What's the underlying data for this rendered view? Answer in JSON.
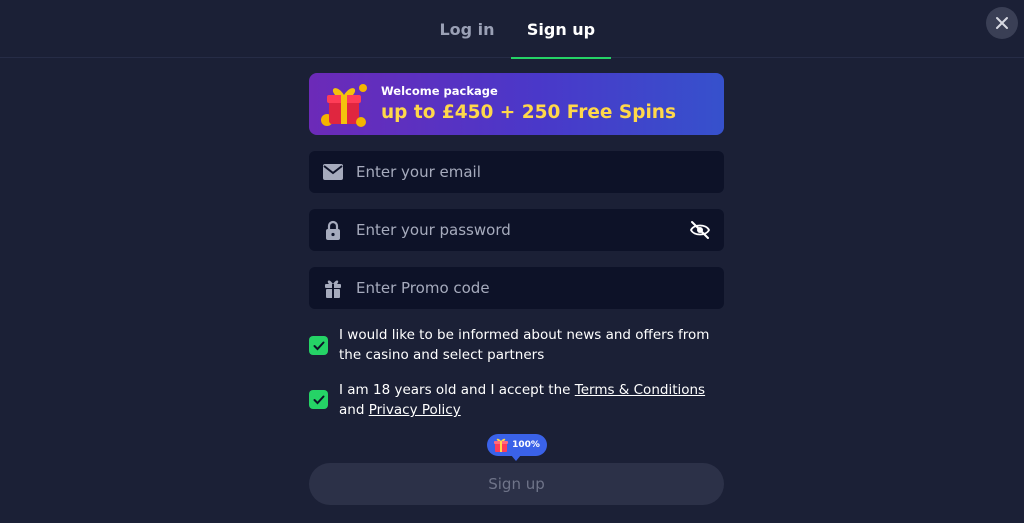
{
  "tabs": {
    "login": "Log in",
    "signup": "Sign up"
  },
  "banner": {
    "subtitle": "Welcome package",
    "title": "up to £450 + 250 Free Spins"
  },
  "form": {
    "email_placeholder": "Enter your email",
    "password_placeholder": "Enter your password",
    "promo_placeholder": "Enter Promo code"
  },
  "consents": {
    "news_text": "I would like to be informed about news and offers from the casino and select partners",
    "news_checked": true,
    "age_prefix": "I am 18 years old and I accept the",
    "terms_link": "Terms & Conditions",
    "age_and": "and",
    "privacy_link": "Privacy Policy",
    "age_checked": true
  },
  "progress": {
    "label": "100%",
    "percent": 100
  },
  "submit_label": "Sign up",
  "colors": {
    "accent": "#25d366",
    "background": "#1b2036",
    "field": "#0d1228",
    "promo_yellow": "#ffd84a",
    "bubble_blue": "#3a62e8"
  },
  "icons": [
    "close-icon",
    "gift-box-icon",
    "email-icon",
    "lock-icon",
    "eye-off-icon",
    "gift-icon",
    "check-icon"
  ]
}
